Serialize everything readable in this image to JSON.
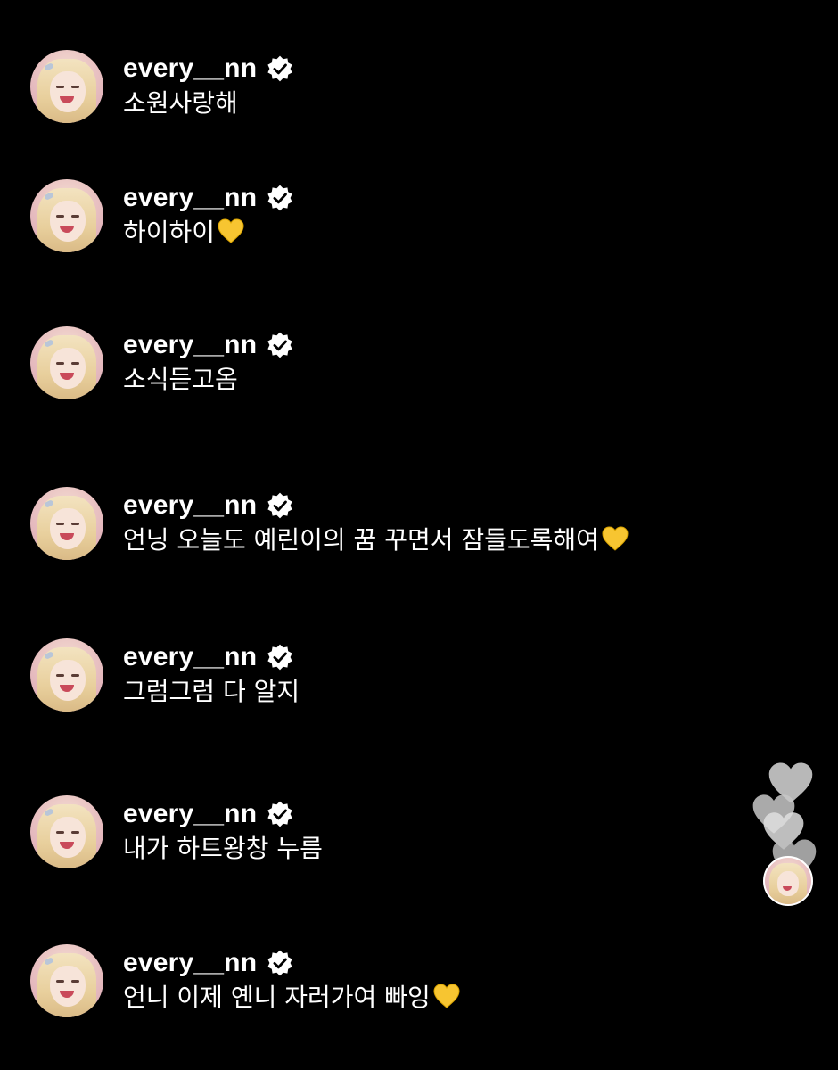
{
  "colors": {
    "background": "#000000",
    "text": "#ffffff",
    "heart_emoji": "#f7c531",
    "floating_heart": "#d9d9d9"
  },
  "comments": [
    {
      "username": "every__nn",
      "verified_icon": "verified-badge-icon",
      "message": "소원사랑해",
      "emoji": ""
    },
    {
      "username": "every__nn",
      "verified_icon": "verified-badge-icon",
      "message": "하이하이",
      "emoji": "yellow-heart-icon"
    },
    {
      "username": "every__nn",
      "verified_icon": "verified-badge-icon",
      "message": "소식듣고옴",
      "emoji": ""
    },
    {
      "username": "every__nn",
      "verified_icon": "verified-badge-icon",
      "message": "언닝 오늘도 예린이의 꿈 꾸면서 잠들도록해여",
      "emoji": "yellow-heart-icon"
    },
    {
      "username": "every__nn",
      "verified_icon": "verified-badge-icon",
      "message": "그럼그럼 다 알지",
      "emoji": ""
    },
    {
      "username": "every__nn",
      "verified_icon": "verified-badge-icon",
      "message": "내가 하트왕창 누름",
      "emoji": ""
    },
    {
      "username": "every__nn",
      "verified_icon": "verified-badge-icon",
      "message": "언니 이제 옌니 자러가여 빠잉",
      "emoji": "yellow-heart-icon"
    }
  ],
  "floating_hearts": [
    "heart-icon",
    "heart-icon",
    "heart-icon",
    "heart-icon"
  ]
}
